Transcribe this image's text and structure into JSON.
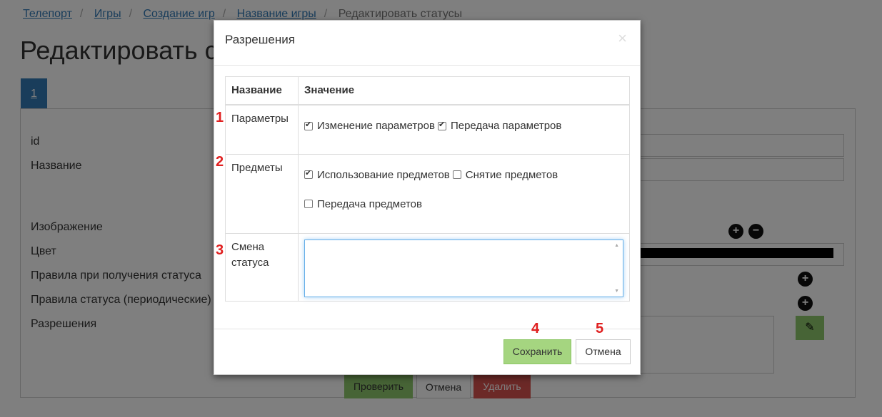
{
  "breadcrumb": [
    "Телепорт",
    "Игры",
    "Создание игр",
    "Название игры"
  ],
  "breadcrumb_current": "Редактировать статусы",
  "page_title": "Редактировать статусы",
  "tab_label": "1",
  "form": {
    "labels": [
      "id",
      "Название",
      "Изображение",
      "Цвет",
      "Правила при получения статуса",
      "Правила статуса (периодические)",
      "Разрешения"
    ],
    "check_button": "Проверить",
    "cancel_button": "Отмена",
    "delete_button": "Удалить"
  },
  "modal": {
    "title": "Разрешения",
    "close": "×",
    "table": {
      "headers": [
        "Название",
        "Значение"
      ],
      "rows": [
        {
          "name": "Параметры",
          "options": [
            {
              "label": "Изменение параметров",
              "checked": true
            },
            {
              "label": "Передача параметров",
              "checked": true
            }
          ]
        },
        {
          "name": "Предметы",
          "options": [
            {
              "label": "Использование предметов",
              "checked": true
            },
            {
              "label": "Снятие предметов",
              "checked": false
            },
            {
              "label": "Передача предметов",
              "checked": false
            }
          ]
        },
        {
          "name": "Смена статуса",
          "value": ""
        }
      ]
    },
    "save_button": "Сохранить",
    "cancel_button": "Отмена"
  },
  "markers": [
    "1",
    "2",
    "3",
    "4",
    "5"
  ],
  "colors": {
    "primary": "#337ab7",
    "success": "#a5d580",
    "danger": "#d9534f",
    "marker": "#e02020"
  }
}
